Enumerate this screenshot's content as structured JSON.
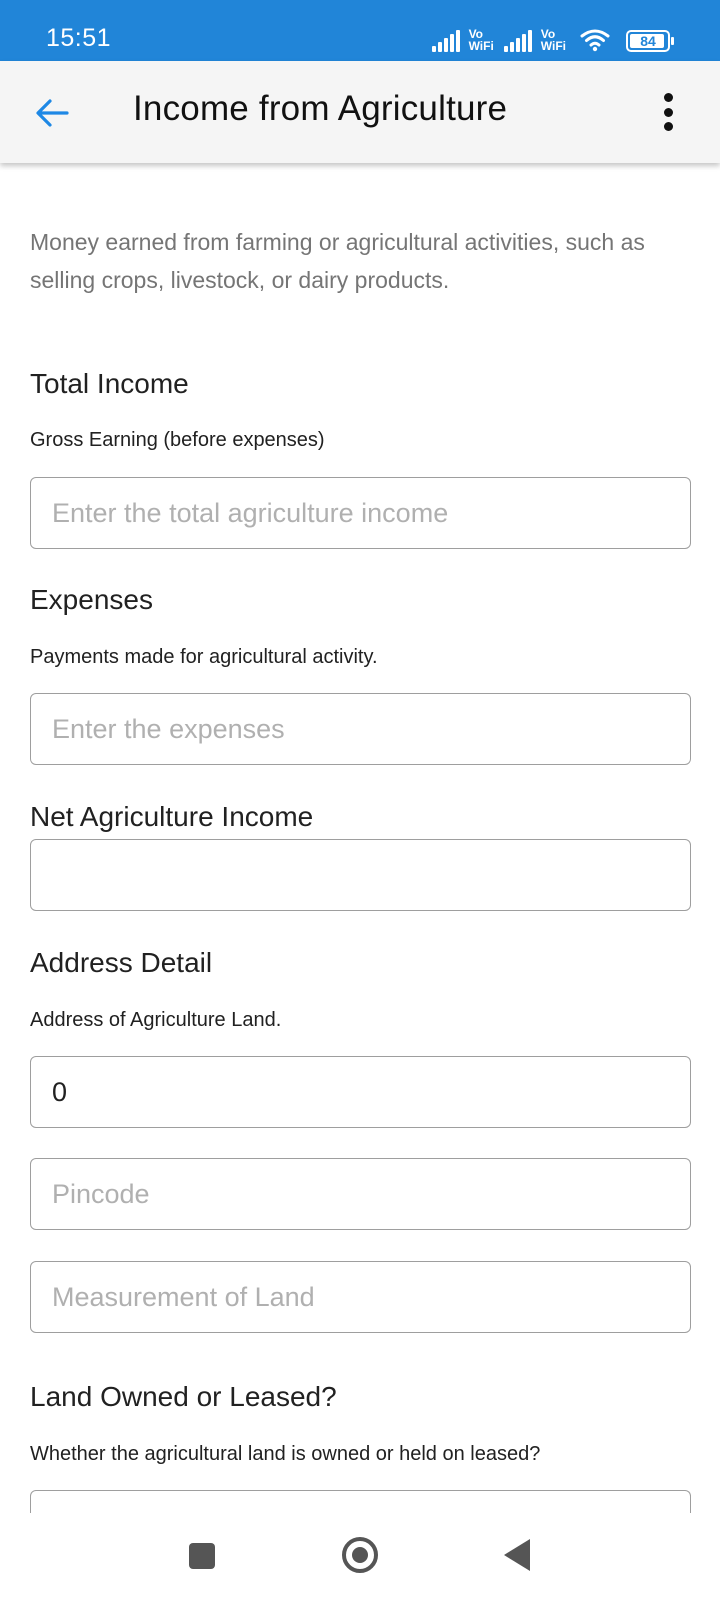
{
  "status_bar": {
    "time": "15:51",
    "network_label_1": "Vo",
    "network_label_1b": "WiFi",
    "network_label_2": "Vo",
    "network_label_2b": "WiFi",
    "battery": "84",
    "color": "#2185d8"
  },
  "app_bar": {
    "title": "Income from Agriculture",
    "back_icon": "arrow-left-icon",
    "menu_icon": "more-vertical-icon",
    "accent": "#1e88e5"
  },
  "intro_text": "Money earned from farming or agricultural activities, such as selling crops, livestock, or dairy products.",
  "sections": {
    "total_income": {
      "title": "Total Income",
      "subtitle": "Gross Earning (before expenses)",
      "placeholder": "Enter the total agriculture income",
      "value": ""
    },
    "expenses": {
      "title": "Expenses",
      "subtitle": "Payments made for agricultural activity.",
      "placeholder": "Enter the expenses",
      "value": ""
    },
    "net_income": {
      "title": "Net Agriculture Income",
      "placeholder": "",
      "value": ""
    },
    "address": {
      "title": "Address Detail",
      "subtitle": "Address of Agriculture Land.",
      "address_value": "0",
      "pincode_placeholder": "Pincode",
      "measurement_placeholder": "Measurement of Land"
    },
    "land_owned": {
      "title": "Land Owned or Leased?",
      "subtitle": "Whether the agricultural land is owned or held on leased?"
    }
  },
  "nav_bar": {
    "recents_icon": "square-icon",
    "home_icon": "circle-icon",
    "back_icon": "triangle-back-icon"
  }
}
